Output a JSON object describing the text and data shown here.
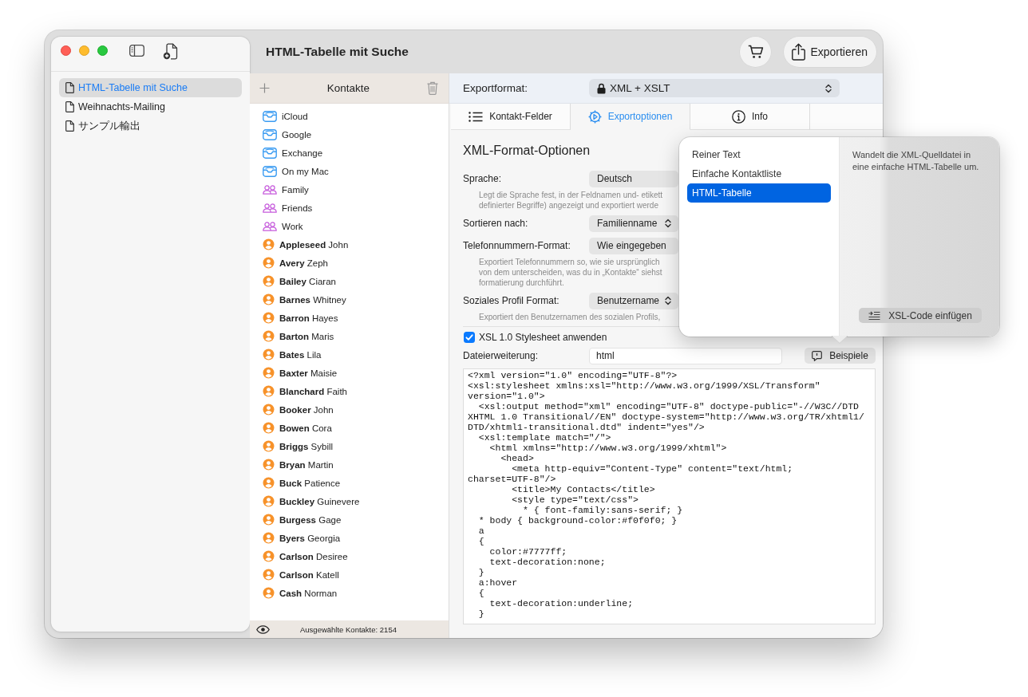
{
  "window": {
    "title": "HTML-Tabelle mit Suche"
  },
  "toolbar": {
    "export_button": "Exportieren"
  },
  "sidebar": {
    "items": [
      {
        "label": "HTML-Tabelle mit Suche",
        "selected": true
      },
      {
        "label": "Weihnachts-Mailing",
        "selected": false
      },
      {
        "label": "サンプル輸出",
        "selected": false
      }
    ]
  },
  "contacts": {
    "title": "Kontakte",
    "items": [
      {
        "kind": "account",
        "name": "iCloud"
      },
      {
        "kind": "account",
        "name": "Google"
      },
      {
        "kind": "account",
        "name": "Exchange"
      },
      {
        "kind": "account",
        "name": "On my Mac"
      },
      {
        "kind": "group",
        "name": "Family"
      },
      {
        "kind": "group",
        "name": "Friends"
      },
      {
        "kind": "group",
        "name": "Work"
      },
      {
        "kind": "contact",
        "name": "**Appleseed** John"
      },
      {
        "kind": "contact",
        "name": "**Avery** Zeph"
      },
      {
        "kind": "contact",
        "name": "**Bailey** Ciaran"
      },
      {
        "kind": "contact",
        "name": "**Barnes** Whitney"
      },
      {
        "kind": "contact",
        "name": "**Barron** Hayes"
      },
      {
        "kind": "contact",
        "name": "**Barton** Maris"
      },
      {
        "kind": "contact",
        "name": "**Bates** Lila"
      },
      {
        "kind": "contact",
        "name": "**Baxter** Maisie"
      },
      {
        "kind": "contact",
        "name": "**Blanchard** Faith"
      },
      {
        "kind": "contact",
        "name": "**Booker** John"
      },
      {
        "kind": "contact",
        "name": "**Bowen** Cora"
      },
      {
        "kind": "contact",
        "name": "**Briggs** Sybill"
      },
      {
        "kind": "contact",
        "name": "**Bryan** Martin"
      },
      {
        "kind": "contact",
        "name": "**Buck** Patience"
      },
      {
        "kind": "contact",
        "name": "**Buckley** Guinevere"
      },
      {
        "kind": "contact",
        "name": "**Burgess** Gage"
      },
      {
        "kind": "contact",
        "name": "**Byers** Georgia"
      },
      {
        "kind": "contact",
        "name": "**Carlson** Desiree"
      },
      {
        "kind": "contact",
        "name": "**Carlson** Katell"
      },
      {
        "kind": "contact",
        "name": "**Cash** Norman"
      }
    ],
    "footer": "Ausgewählte Kontakte: 2154"
  },
  "export": {
    "format_label": "Exportformat:",
    "format_value": "XML + XSLT",
    "tabs": [
      {
        "label": "Kontakt-Felder",
        "selected": false
      },
      {
        "label": "Exportoptionen",
        "selected": true
      },
      {
        "label": "Info",
        "selected": false
      }
    ],
    "heading": "XML-Format-Optionen",
    "options": [
      {
        "label": "Sprache:",
        "value": "Deutsch",
        "chevron": false,
        "description": [
          "Legt die Sprache fest, in der Feldnamen und- etikett",
          "definierter Begriffe) angezeigt und exportiert werde"
        ]
      },
      {
        "label": "Sortieren nach:",
        "value": "Familienname",
        "chevron": true
      },
      {
        "label": "Telefonnummern-Format:",
        "value": "Wie eingegeben",
        "chevron": false,
        "description": [
          "Exportiert Telefonnummern so, wie sie ursprünglich",
          "von dem unterscheiden, was du in „Kontakte“ siehst",
          "formatierung durchführt."
        ]
      },
      {
        "label": "Soziales Profil Format:",
        "value": "Benutzername",
        "chevron": true,
        "description": [
          "Exportiert den Benutzernamen des sozialen Profils,"
        ]
      }
    ],
    "xsl_checkbox": {
      "label": "XSL 1.0 Stylesheet anwenden",
      "checked": true
    },
    "extension": {
      "label": "Dateierweiterung:",
      "value": "html"
    },
    "examples_button": "Beispiele",
    "code": [
      "<?xml version=\"1.0\" encoding=\"UTF-8\"?>",
      "<xsl:stylesheet xmlns:xsl=\"http://www.w3.org/1999/XSL/Transform\"",
      "version=\"1.0\">",
      "  <xsl:output method=\"xml\" encoding=\"UTF-8\" doctype-public=\"-//W3C//DTD",
      "XHTML 1.0 Transitional//EN\" doctype-system=\"http://www.w3.org/TR/xhtml1/",
      "DTD/xhtml1-transitional.dtd\" indent=\"yes\"/>",
      "  <xsl:template match=\"/\">",
      "    <html xmlns=\"http://www.w3.org/1999/xhtml\">",
      "      <head>",
      "        <meta http-equiv=\"Content-Type\" content=\"text/html;",
      "charset=UTF-8\"/>",
      "        <title>My Contacts</title>",
      "        <style type=\"text/css\">",
      "          * { font-family:sans-serif; }",
      "  * body { background-color:#f0f0f0; }",
      "  a",
      "  {",
      "    color:#7777ff;",
      "    text-decoration:none;",
      "  }",
      "  a:hover",
      "  {",
      "    text-decoration:underline;",
      "  }"
    ]
  },
  "popover": {
    "items": [
      {
        "label": "Reiner Text",
        "selected": false
      },
      {
        "label": "Einfache Kontaktliste",
        "selected": false
      },
      {
        "label": "HTML-Tabelle",
        "selected": true
      }
    ],
    "description": "Wandelt die XML-Quelldatei in eine einfache HTML-Tabelle um.",
    "insert_button": "XSL-Code einfügen"
  }
}
